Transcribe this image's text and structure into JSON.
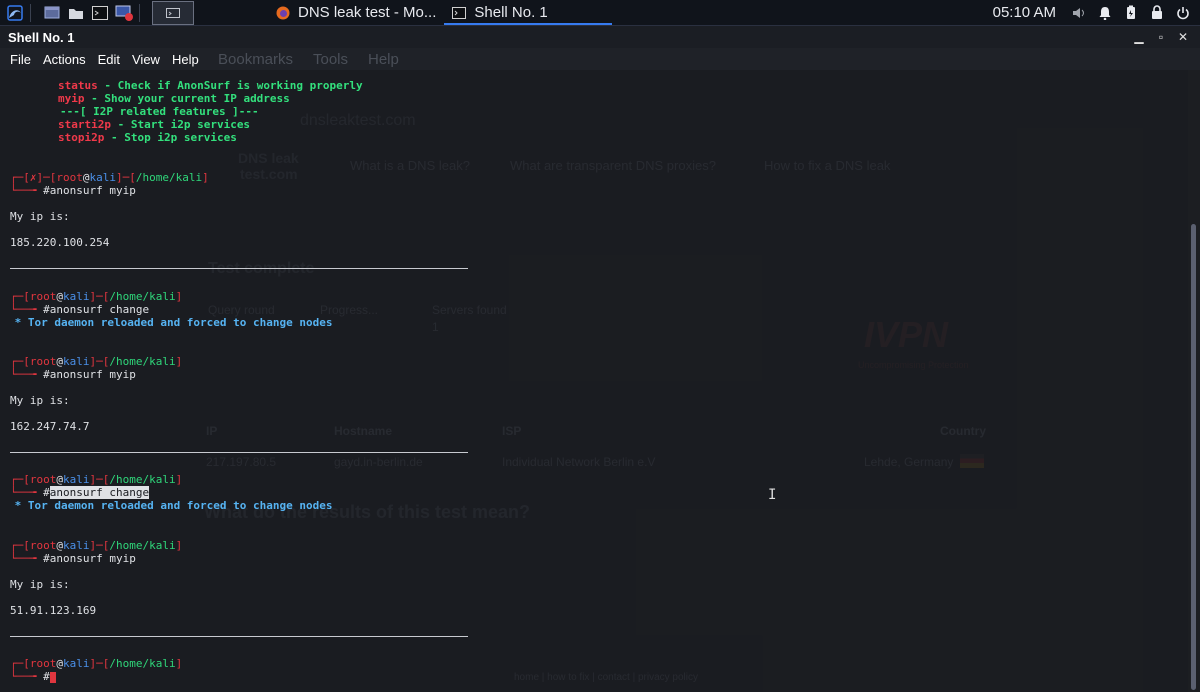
{
  "taskbar": {
    "tasks": [
      {
        "label": "DNS leak test - Mo...",
        "icon": "firefox-icon"
      },
      {
        "label": "Shell No. 1",
        "icon": "terminal-icon"
      }
    ],
    "clock": "05:10 AM"
  },
  "window": {
    "title": "Shell No. 1",
    "menu": [
      "File",
      "Actions",
      "Edit",
      "View",
      "Help"
    ]
  },
  "terminal": {
    "help": {
      "status_cmd": "status",
      "status_desc": " - Check if AnonSurf is working properly",
      "myip_cmd": "myip",
      "myip_desc": " - Show your current IP address",
      "i2p_header": "---[ I2P related features ]---",
      "starti2p_cmd": "starti2p",
      "starti2p_desc": " - Start i2p services",
      "stopi2p_cmd": "stopi2p",
      "stopi2p_desc": " - Stop i2p services"
    },
    "prompt": {
      "x_mark": "✗",
      "user": "root",
      "at": "@",
      "host": "kali",
      "path": "/home/kali",
      "hash": "#"
    },
    "cmd_myip": "anonsurf myip",
    "cmd_change": "anonsurf change",
    "my_ip_label": "My ip is:",
    "change_msg": " * Tor daemon reloaded and forced to change nodes",
    "ip1": "185.220.100.254",
    "ip2": "162.247.74.7",
    "ip3": "51.91.123.169"
  },
  "background_page": {
    "menu_bookmarks": "Bookmarks",
    "menu_tools": "Tools",
    "menu_help": "Help",
    "url": "dnsleaktest.com",
    "logo_line1": "DNS leak",
    "logo_line2": "test.com",
    "nav1": "What is a DNS leak?",
    "nav2": "What are transparent DNS proxies?",
    "nav3": "How to fix a DNS leak",
    "heading": "Test complete",
    "col_query": "Query round",
    "col_progress": "Progress...",
    "col_servers": "Servers found",
    "servers_count": "1",
    "ivpn": "IVPN",
    "ivpn_sub": "Uncompromising Protection",
    "th_ip": "IP",
    "th_hostname": "Hostname",
    "th_isp": "ISP",
    "th_country": "Country",
    "row_ip": "217.197.80.5",
    "row_hostname": "gayd.in-berlin.de",
    "row_isp": "Individual Network Berlin e.V",
    "row_country": "Lehde, Germany",
    "results_heading": "What do the results of this test mean?",
    "footer": "home | how to fix | contact | privacy policy"
  }
}
